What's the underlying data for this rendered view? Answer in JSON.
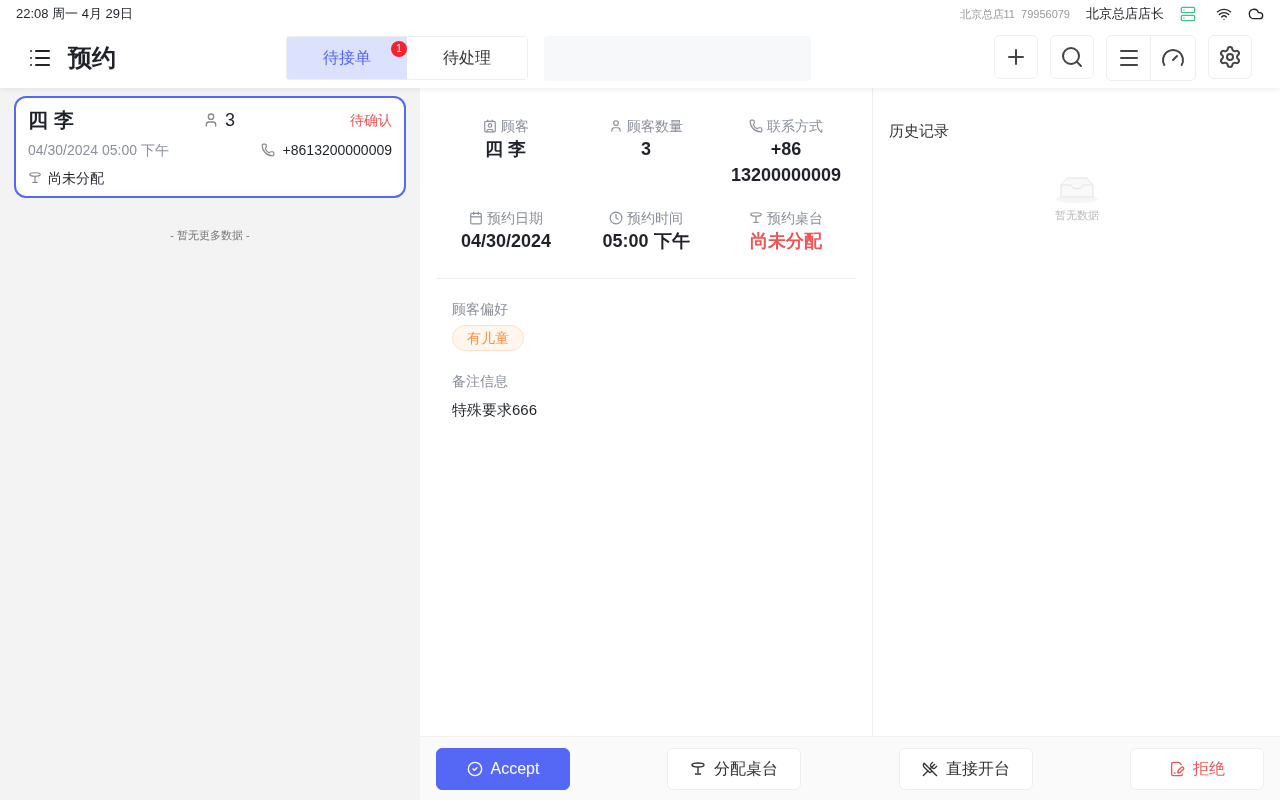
{
  "status_bar": {
    "time": "22:08 周一 4月 29日",
    "store_id": "北京总店11  79956079",
    "user": "北京总店店长"
  },
  "header": {
    "title": "预约",
    "tabs": [
      {
        "label": "待接单",
        "selected": true,
        "badge": "1"
      },
      {
        "label": "待处理",
        "selected": false
      }
    ]
  },
  "list": {
    "cards": [
      {
        "name": "四 李",
        "guests": "3",
        "status": "待确认",
        "datetime": "04/30/2024 05:00 下午",
        "phone": "+8613200000009",
        "table": "尚未分配",
        "selected": true
      }
    ],
    "footer": "- 暂无更多数据 -"
  },
  "details": {
    "fields": [
      {
        "kind": "customer",
        "label": "顾客",
        "value": "四 李",
        "alert": false
      },
      {
        "kind": "guests",
        "label": "顾客数量",
        "value": "3",
        "alert": false
      },
      {
        "kind": "phone",
        "label": "联系方式",
        "value": "+86 13200000009",
        "alert": false
      },
      {
        "kind": "date",
        "label": "预约日期",
        "value": "04/30/2024",
        "alert": false
      },
      {
        "kind": "time",
        "label": "预约时间",
        "value": "05:00 下午",
        "alert": false
      },
      {
        "kind": "table",
        "label": "预约桌台",
        "value": "尚未分配",
        "alert": true
      }
    ],
    "preferences_label": "顾客偏好",
    "preferences": [
      "有儿童"
    ],
    "notes_label": "备注信息",
    "notes": "特殊要求666"
  },
  "history": {
    "title": "历史记录",
    "empty": "暂无数据"
  },
  "actions": [
    {
      "kind": "accept",
      "label": "Accept"
    },
    {
      "kind": "assign",
      "label": "分配桌台"
    },
    {
      "kind": "open",
      "label": "直接开台"
    },
    {
      "kind": "reject",
      "label": "拒绝"
    }
  ]
}
